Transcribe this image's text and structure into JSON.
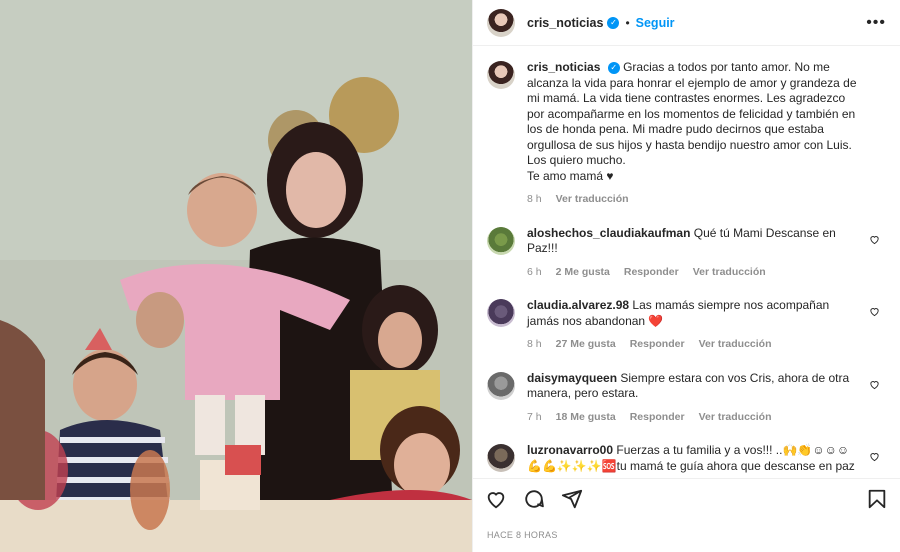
{
  "header": {
    "username": "cris_noticias",
    "separator": "•",
    "follow_label": "Seguir",
    "more_label": "•••"
  },
  "caption": {
    "username": "cris_noticias",
    "lines": [
      "Gracias a todos por tanto amor. No me alcanza la vida para honrar el ejemplo de amor y grandeza de mi mamá. La vida tiene contrastes enormes. Les agradezco por acompañarme en los momentos de felicidad y también en los de honda pena. Mi madre pudo decirnos que estaba orgullosa de sus hijos y hasta bendijo nuestro amor con Luis.",
      "Los quiero mucho.",
      "Te amo mamá ♥"
    ],
    "time": "8 h",
    "see_translation": "Ver traducción"
  },
  "comments": [
    {
      "username": "aloshechos_claudiakaufman",
      "text": "Qué tú Mami Descanse en Paz!!!",
      "time": "6 h",
      "likes": "2 Me gusta",
      "reply": "Responder",
      "see_translation": "Ver traducción"
    },
    {
      "username": "claudia.alvarez.98",
      "text": "Las mamás siempre nos acompañan jamás nos abandonan ❤️",
      "time": "8 h",
      "likes": "27 Me gusta",
      "reply": "Responder",
      "see_translation": "Ver traducción"
    },
    {
      "username": "daisymayqueen",
      "text": "Siempre estara con vos Cris, ahora de otra manera, pero estara.",
      "time": "7 h",
      "likes": "18 Me gusta",
      "reply": "Responder",
      "see_translation": "Ver traducción"
    },
    {
      "username": "luzronavarro00",
      "text": "Fuerzas a tu familia y a vos!!! ..🙌👏☺☺☺💪💪✨✨✨🆘tu mamá te guía ahora que descanse en paz",
      "time": "",
      "likes": "",
      "reply": "",
      "see_translation": ""
    }
  ],
  "footer": {
    "timestamp": "HACE 8 HORAS"
  },
  "icons": {
    "verified": "verified-badge-icon",
    "like": "heart-icon",
    "comment": "comment-icon",
    "share": "share-icon",
    "save": "bookmark-icon"
  },
  "colors": {
    "accent": "#0095f6",
    "text": "#262626",
    "muted": "#8e8e8e",
    "heart_red": "#ed4956"
  }
}
